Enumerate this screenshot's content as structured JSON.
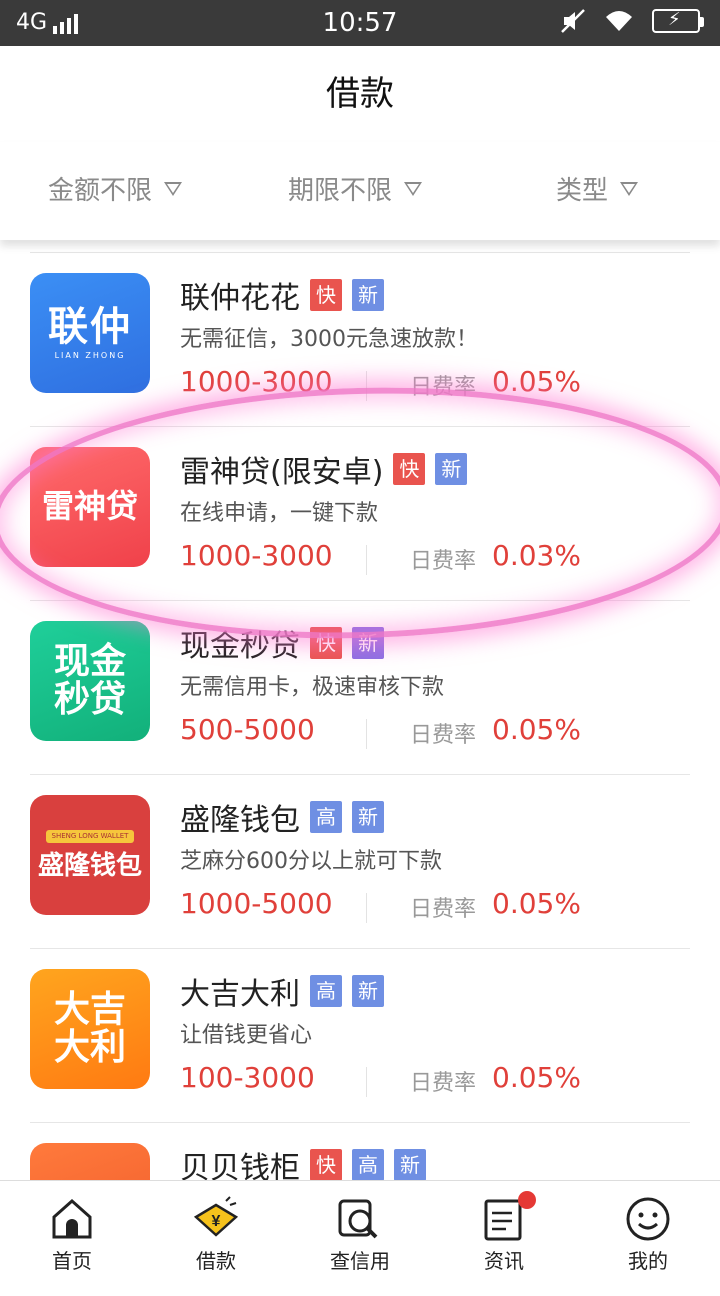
{
  "status": {
    "network": "4G",
    "time": "10:57"
  },
  "header": {
    "title": "借款"
  },
  "filters": [
    {
      "label": "金额不限"
    },
    {
      "label": "期限不限"
    },
    {
      "label": "类型"
    }
  ],
  "loans": [
    {
      "name": "联仲花花",
      "tags": [
        "快",
        "新"
      ],
      "desc": "无需征信，3000元急速放款！",
      "range": "1000-3000",
      "rate_label": "日费率",
      "rate": "0.05%",
      "logo": "联仲",
      "logo_sub": "LIAN ZHONG"
    },
    {
      "name": "雷神贷(限安卓)",
      "tags": [
        "快",
        "新"
      ],
      "desc": "在线申请，一键下款",
      "range": "1000-3000",
      "rate_label": "日费率",
      "rate": "0.03%",
      "logo": "雷神贷"
    },
    {
      "name": "现金秒贷",
      "tags": [
        "快",
        "新"
      ],
      "desc": "无需信用卡，极速审核下款",
      "range": "500-5000",
      "rate_label": "日费率",
      "rate": "0.05%",
      "logo": "现金 秒贷"
    },
    {
      "name": "盛隆钱包",
      "tags": [
        "高",
        "新"
      ],
      "desc": "芝麻分600分以上就可下款",
      "range": "1000-5000",
      "rate_label": "日费率",
      "rate": "0.05%",
      "logo": "盛隆钱包",
      "logo_sub": "SHENG LONG WALLET"
    },
    {
      "name": "大吉大利",
      "tags": [
        "高",
        "新"
      ],
      "desc": "让借钱更省心",
      "range": "100-3000",
      "rate_label": "日费率",
      "rate": "0.05%",
      "logo": "大吉 大利"
    },
    {
      "name": "贝贝钱柜",
      "tags": [
        "快",
        "高",
        "新"
      ],
      "desc": "",
      "range": "",
      "rate_label": "",
      "rate": "",
      "logo": ""
    }
  ],
  "tabbar": [
    {
      "label": "首页",
      "icon": "home-icon"
    },
    {
      "label": "借款",
      "icon": "yen-tag-icon"
    },
    {
      "label": "查信用",
      "icon": "credit-search-icon"
    },
    {
      "label": "资讯",
      "icon": "news-icon"
    },
    {
      "label": "我的",
      "icon": "smiley-icon"
    }
  ],
  "colors": {
    "accent_red": "#e0403a",
    "tag_red": "#e9544e",
    "tag_blue": "#6f8fe3",
    "highlight_pink": "#f078c8"
  }
}
